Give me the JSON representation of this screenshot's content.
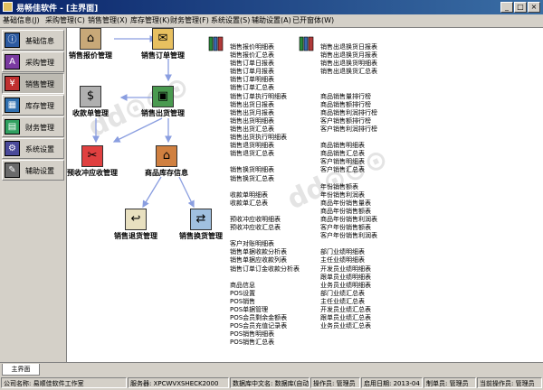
{
  "window": {
    "title": "易畅佳软件 - [主界面]",
    "buttons": [
      "_",
      "□",
      "×"
    ]
  },
  "menu": [
    "基础信息(J)",
    "采购管理(C)",
    "销售管理(X)",
    "库存管理(K)",
    "财务管理(F)",
    "系统设置(S)",
    "辅助设置(A)",
    "已开窗体(W)"
  ],
  "sidebar": {
    "items": [
      {
        "label": "基础信息",
        "icon": "info-icon"
      },
      {
        "label": "采购管理",
        "icon": "purchase-icon"
      },
      {
        "label": "销售管理",
        "icon": "sales-icon",
        "active": true
      },
      {
        "label": "库存管理",
        "icon": "inventory-icon"
      },
      {
        "label": "财务管理",
        "icon": "finance-icon"
      },
      {
        "label": "系统设置",
        "icon": "settings-icon"
      },
      {
        "label": "辅助设置",
        "icon": "tools-icon"
      }
    ]
  },
  "flow": {
    "quote": "销售报价管理",
    "order": "销售订单管理",
    "receipt": "收款单管理",
    "outbound": "销售出货管理",
    "prepay": "预收冲应收管理",
    "stock": "商品库存信息",
    "return": "销售退货管理",
    "exchange": "销售换货管理"
  },
  "reports": {
    "col1": [
      "销售报价明细表",
      "销售报价汇总表",
      "销售订单日报表",
      "销售订单月报表",
      "销售订单明细表",
      "销售订单汇总表",
      "销售订单执行明细表",
      "销售出货日报表",
      "销售出货月报表",
      "销售出货明细表",
      "销售出货汇总表",
      "销售出货执行明细表",
      "销售退货明细表",
      "销售退货汇总表",
      "",
      "销售换货明细表",
      "销售换货汇总表",
      "",
      "收款单明细表",
      "收款单汇总表",
      "",
      "预收冲应收明细表",
      "预收冲应收汇总表",
      "",
      "客户对账明细表",
      "销售单据收款分析表",
      "销售单据应收款列表",
      "销售订单订金收款分析表",
      "",
      "商品信息",
      "POS设置",
      "POS销售",
      "POS单据管理",
      "POS会员剩余金额表",
      "POS会员充值记录表",
      "POS销售明细表",
      "POS销售汇总表"
    ],
    "col2": [
      "销售出退换货日报表",
      "销售出退换货月报表",
      "销售出退换货明细表",
      "销售出退换货汇总表",
      "",
      "",
      "商品销售量排行榜",
      "商品销售额排行榜",
      "商品销售利润排行榜",
      "客户销售额排行榜",
      "客户销售利润排行榜",
      "",
      "商品销售明细表",
      "商品销售汇总表",
      "客户销售明细表",
      "客户销售汇总表",
      "",
      "年份销售额表",
      "年份销售利润表",
      "商品年份销售量表",
      "商品年份销售额表",
      "商品年份销售利润表",
      "客户年份销售额表",
      "客户年份销售利润表",
      "",
      "部门业绩明细表",
      "主任业绩明细表",
      "开发员业绩明细表",
      "跟单员业绩明细表",
      "业务员业绩明细表",
      "部门业绩汇总表",
      "主任业绩汇总表",
      "开发员业绩汇总表",
      "跟单员业绩汇总表",
      "业务员业绩汇总表"
    ]
  },
  "tabs": [
    "主界面"
  ],
  "status": {
    "company": "公司名称: 易顺佳软件工作室",
    "server": "服务器: XPCWVXSHECK2000",
    "db": "数据库中文名: 数据库(自动)",
    "operator": "操作员: 管理员",
    "date": "启用日期: 2013-04",
    "maker": "制单员: 管理员",
    "current": "当前操作员: 管理员"
  }
}
